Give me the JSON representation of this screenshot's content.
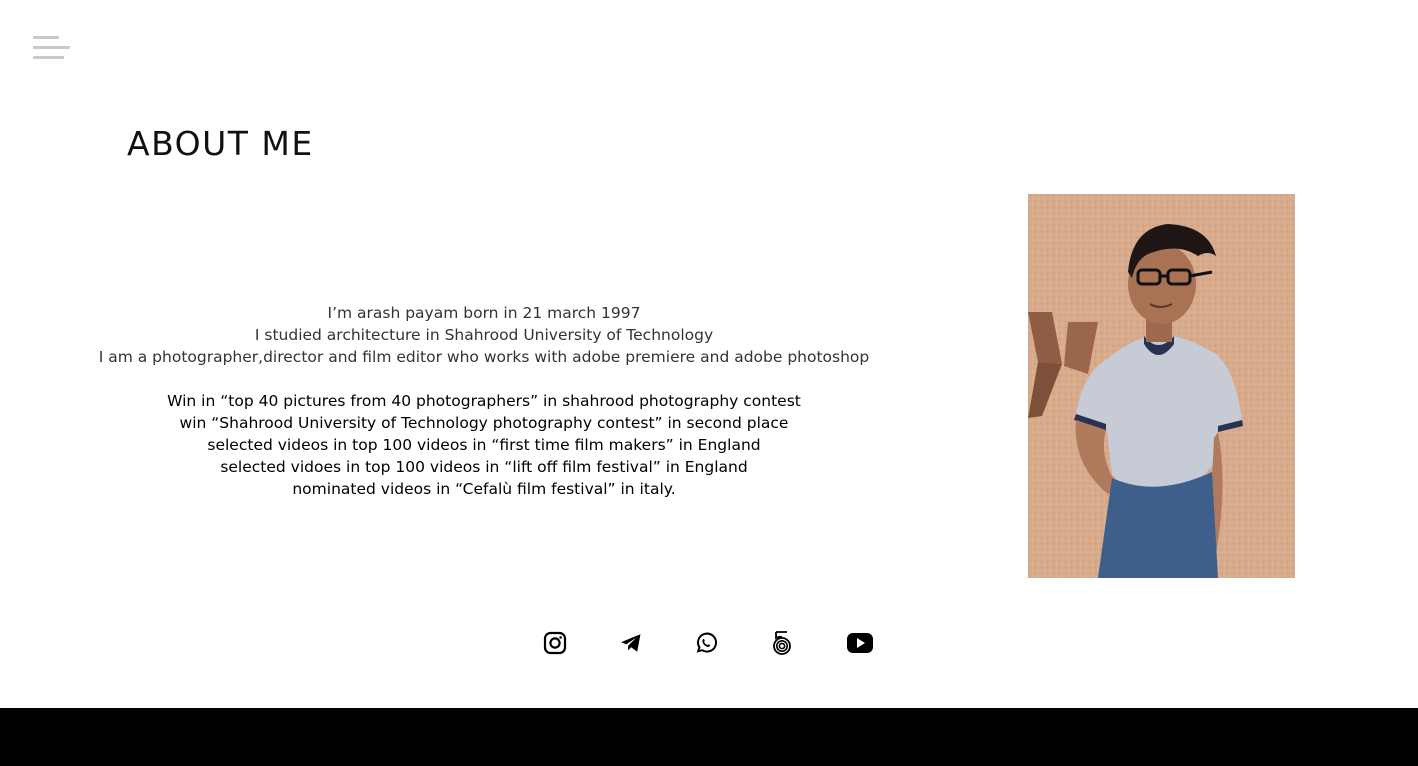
{
  "header": {
    "menu_icon": "hamburger-icon"
  },
  "about": {
    "title": "ABOUT ME",
    "bio_lines": [
      "I’m arash payam born in 21 march 1997",
      "I studied architecture in Shahrood University of Technology",
      "I am a photographer,director and film editor who works with adobe premiere and adobe photoshop"
    ],
    "awards": [
      "Win in “top 40 pictures from 40 photographers” in shahrood photography contest",
      "win “Shahrood University of Technology photography contest” in second place",
      "selected videos in top 100 videos in “first time film makers” in England",
      "selected vidoes in top 100 videos in “lift off film festival” in England",
      "nominated videos in “Cefalù film festival” in italy."
    ]
  },
  "social": [
    {
      "name": "instagram",
      "icon": "instagram-icon"
    },
    {
      "name": "telegram",
      "icon": "telegram-icon"
    },
    {
      "name": "whatsapp",
      "icon": "whatsapp-icon"
    },
    {
      "name": "500px",
      "icon": "500px-icon"
    },
    {
      "name": "youtube",
      "icon": "youtube-icon"
    }
  ],
  "colors": {
    "background": "#ffffff",
    "text": "#111111",
    "footer": "#000000",
    "menu_icon": "#c9c9c9"
  }
}
